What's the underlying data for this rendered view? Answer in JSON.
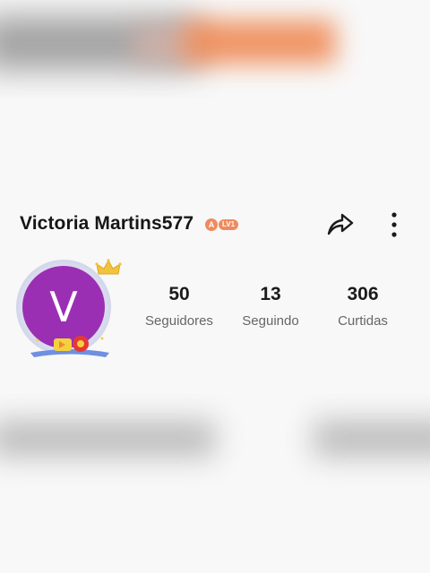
{
  "profile": {
    "username": "Victoria Martins577",
    "level_label": "LV1",
    "level_icon_text": "A",
    "avatar_letter": "V",
    "avatar_color": "#9b2fb4"
  },
  "stats": {
    "followers_count": "50",
    "followers_label": "Seguidores",
    "following_count": "13",
    "following_label": "Seguindo",
    "likes_count": "306",
    "likes_label": "Curtidas"
  },
  "icons": {
    "share": "share-icon",
    "more": "more-vertical-icon",
    "crown": "crown-icon"
  }
}
